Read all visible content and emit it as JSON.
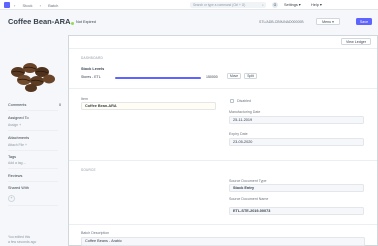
{
  "nav": {
    "breadcrumbs": [
      "Stock",
      "Batch"
    ],
    "search_placeholder": "Search or type a command (Ctrl + G)",
    "avatar_initial": "G",
    "settings_label": "Settings",
    "help_label": "Help"
  },
  "header": {
    "title": "Coffee Bean-ARA",
    "status": "Not Expired",
    "doc_name": "STL/ADB-CB9UNAD00000B",
    "menu_label": "Menu",
    "save_label": "Save",
    "view_ledger_label": "View Ledger"
  },
  "sidebar": {
    "comments_label": "Comments",
    "comments_count": "0",
    "assigned_to_label": "Assigned To",
    "assign_link": "Assign +",
    "attachments_label": "Attachments",
    "attach_link": "Attach File +",
    "tags_label": "Tags",
    "add_tag": "Add a tag ...",
    "reviews_label": "Reviews",
    "shared_with_label": "Shared With",
    "shared_add": "+",
    "activity_text": "You edited this",
    "activity_time": "a few seconds ago"
  },
  "dashboard": {
    "section_label": "DASHBOARD",
    "stock_levels_label": "Stock Levels",
    "store_name": "Stores - ETL",
    "qty": "150000",
    "move_label": "Move",
    "split_label": "Split"
  },
  "form": {
    "item_label": "Item",
    "item_value": "Coffee Bean-ARA",
    "disabled_label": "Disabled",
    "mfg_date_label": "Manufacturing Date",
    "mfg_date_value": "25-11-2019",
    "expiry_date_label": "Expiry Date",
    "expiry_date_value": "23-05-2020",
    "source_section_label": "SOURCE",
    "source_doc_type_label": "Source Document Type",
    "source_doc_type_value": "Stock Entry",
    "source_doc_name_label": "Source Document Name",
    "source_doc_name_value": "ETL-STE-2019-00073",
    "batch_desc_label": "Batch Description",
    "batch_desc_value": "Coffee Beans - Arabic"
  },
  "colors": {
    "primary": "#5e64ff",
    "status_green": "#98d85b",
    "item_highlight": "#fffdf4"
  }
}
